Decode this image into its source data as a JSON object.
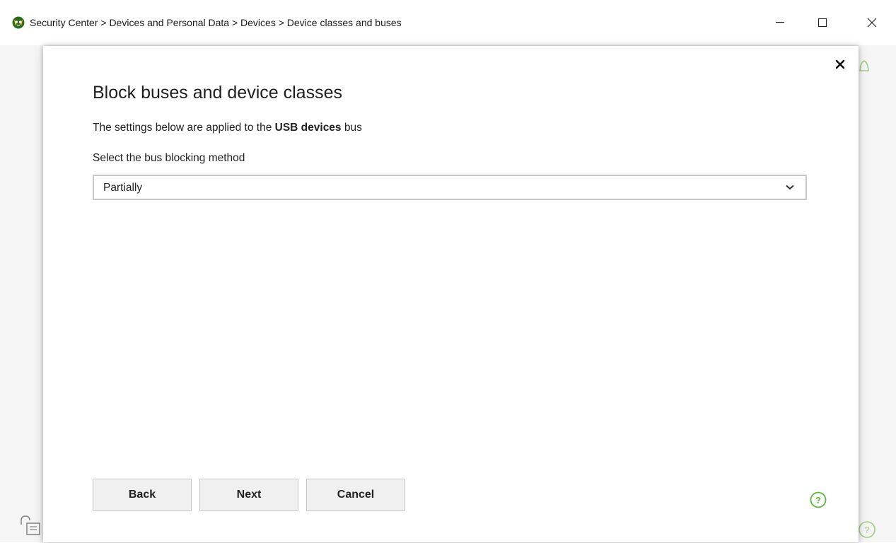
{
  "window": {
    "title": "Security Center > Devices and Personal Data > Devices > Device classes and buses",
    "app_icon": "shield-logo-icon",
    "controls": [
      "minimize-icon",
      "maximize-icon",
      "close-icon"
    ]
  },
  "dialog": {
    "title": "Block buses and device classes",
    "description_prefix": "The settings below are applied to the ",
    "description_bold": "USB devices",
    "description_suffix": " bus",
    "field_label": "Select the bus blocking method",
    "select": {
      "value": "Partially"
    },
    "buttons": {
      "back": "Back",
      "next": "Next",
      "cancel": "Cancel"
    },
    "help_icon": "question-circle-icon",
    "close_icon": "close-icon"
  },
  "colors": {
    "accent_green": "#5ab833",
    "button_bg": "#f0f0f0",
    "select_border": "#c8c8c8"
  }
}
